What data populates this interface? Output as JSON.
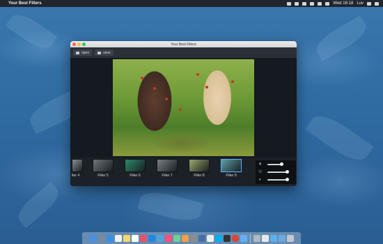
{
  "menubar": {
    "app_name": "Your Best Filters",
    "clock": "Wed 16:18",
    "user": "Luv"
  },
  "window": {
    "title": "Your Best Filters",
    "toolbar": {
      "open_label": "open",
      "save_label": "save"
    }
  },
  "filters": [
    {
      "label": "lter 4"
    },
    {
      "label": "Filter 5"
    },
    {
      "label": "Filter 6"
    },
    {
      "label": "Filter 7"
    },
    {
      "label": "Filter 8"
    },
    {
      "label": "Filter 9",
      "selected": true
    }
  ],
  "adjustments": [
    {
      "name": "brightness",
      "icon": "brightness-icon",
      "level": 0.55
    },
    {
      "name": "exposure",
      "icon": "exposure-icon",
      "level": 0.78
    },
    {
      "name": "contrast",
      "icon": "contrast-icon",
      "level": 0.78
    }
  ],
  "dock_icons": [
    "finder-icon",
    "launchpad-icon",
    "safari-icon",
    "calendar-icon",
    "notes-icon",
    "reminders-icon",
    "photos-icon",
    "app-store-icon",
    "mail-icon",
    "music-icon",
    "maps-icon",
    "ibooks-icon",
    "preferences-icon",
    "xcode-icon",
    "textedit-icon",
    "skype-icon",
    "terminal-icon",
    "chrome-icon",
    "filters-app-icon",
    "photos2-icon",
    "document-icon",
    "folder-icon",
    "downloads-icon",
    "trash-icon"
  ]
}
